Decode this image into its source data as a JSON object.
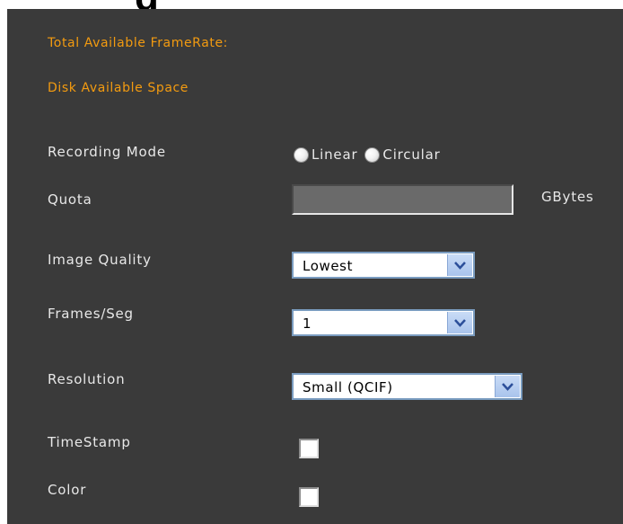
{
  "header": {
    "partial_heading": "g"
  },
  "info": {
    "framerate_label": "Total Available FrameRate:",
    "disk_label": "Disk Available Space"
  },
  "recording_mode": {
    "label": "Recording Mode",
    "options": [
      "Linear",
      "Circular"
    ]
  },
  "quota": {
    "label": "Quota",
    "value": "",
    "unit": "GBytes"
  },
  "image_quality": {
    "label": "Image Quality",
    "selected": "Lowest"
  },
  "frames_per_sec": {
    "label": "Frames/Seg",
    "selected": "1"
  },
  "resolution": {
    "label": "Resolution",
    "selected": "Small (QCIF)"
  },
  "timestamp": {
    "label": "TimeStamp",
    "checked": false
  },
  "color": {
    "label": "Color",
    "checked": false
  },
  "colors": {
    "panel": "#3a3a3a",
    "accent": "#f39b10",
    "text": "#e8e8e8"
  }
}
